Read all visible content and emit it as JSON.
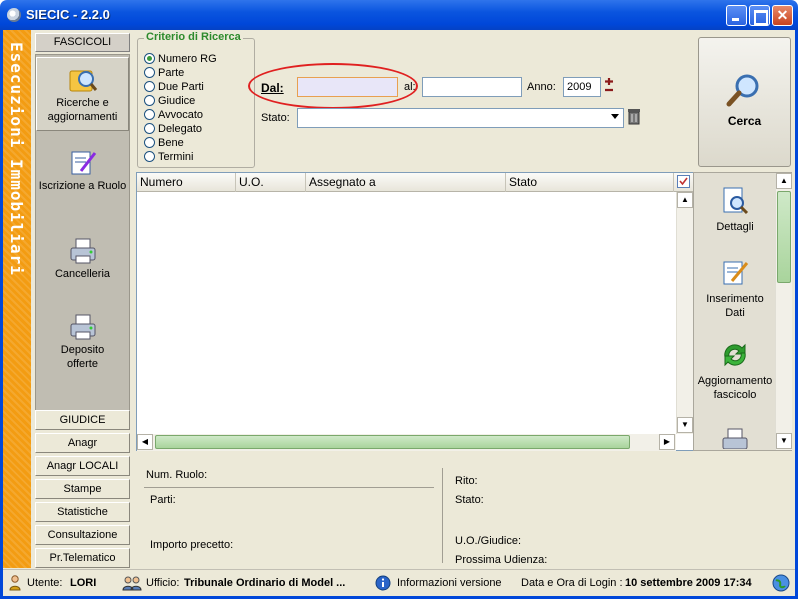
{
  "window": {
    "title": "SIECIC - 2.2.0"
  },
  "banner": {
    "text": "Esecuzioni Immobiliari"
  },
  "nav": {
    "header": "FASCICOLI",
    "items": [
      {
        "label": "Ricerche e aggiornamenti",
        "icon": "search-folder-icon"
      },
      {
        "label": "Iscrizione a Ruolo",
        "icon": "notepad-pen-icon"
      },
      {
        "label": "Cancelleria",
        "icon": "printer-icon"
      },
      {
        "label": "Deposito offerte",
        "icon": "printer-icon"
      }
    ],
    "buttons": [
      "GIUDICE",
      "Anagr DISTRETTO",
      "Anagr LOCALI",
      "Stampe",
      "Statistiche",
      "Consultazione",
      "Pr.Telematico"
    ]
  },
  "criteria": {
    "legend": "Criterio di Ricerca",
    "options": [
      "Numero RG",
      "Parte",
      "Due Parti",
      "Giudice",
      "Avvocato",
      "Delegato",
      "Bene",
      "Termini"
    ],
    "selected": "Numero RG"
  },
  "search": {
    "dal_label": "Dal:",
    "dal_value": "",
    "al_label": "al:",
    "al_value": "",
    "anno_label": "Anno:",
    "anno_value": "2009",
    "stato_label": "Stato:",
    "stato_value": ""
  },
  "cerca_button": {
    "label": "Cerca"
  },
  "grid": {
    "columns": [
      "Numero",
      "U.O.",
      "Assegnato a",
      "Stato"
    ],
    "rows": []
  },
  "actions": [
    {
      "label": "Dettagli",
      "icon": "document-search-icon"
    },
    {
      "label": "Inserimento Dati",
      "icon": "edit-document-icon"
    },
    {
      "label": "Aggiornamento fascicolo",
      "icon": "green-arrows-icon"
    }
  ],
  "details": {
    "num_ruolo_label": "Num. Ruolo:",
    "parti_label": "Parti:",
    "importo_label": "Importo precetto:",
    "rito_label": "Rito:",
    "stato_label": "Stato:",
    "uo_giudice_label": "U.O./Giudice:",
    "prossima_udienza_label": "Prossima Udienza:"
  },
  "statusbar": {
    "utente_label": "Utente:",
    "utente_value": "LORI",
    "ufficio_label": "Ufficio:",
    "ufficio_value": "Tribunale Ordinario di Model ...",
    "info_label": "Informazioni versione",
    "login_label": "Data e Ora di Login :",
    "login_value": "10 settembre 2009 17:34"
  },
  "colors": {
    "titlebar": "#0a55df",
    "banner": "#f39c12",
    "legend": "#2d8a2d",
    "highlight_oval": "#e02020",
    "dal_field": "#e8e6f8"
  }
}
